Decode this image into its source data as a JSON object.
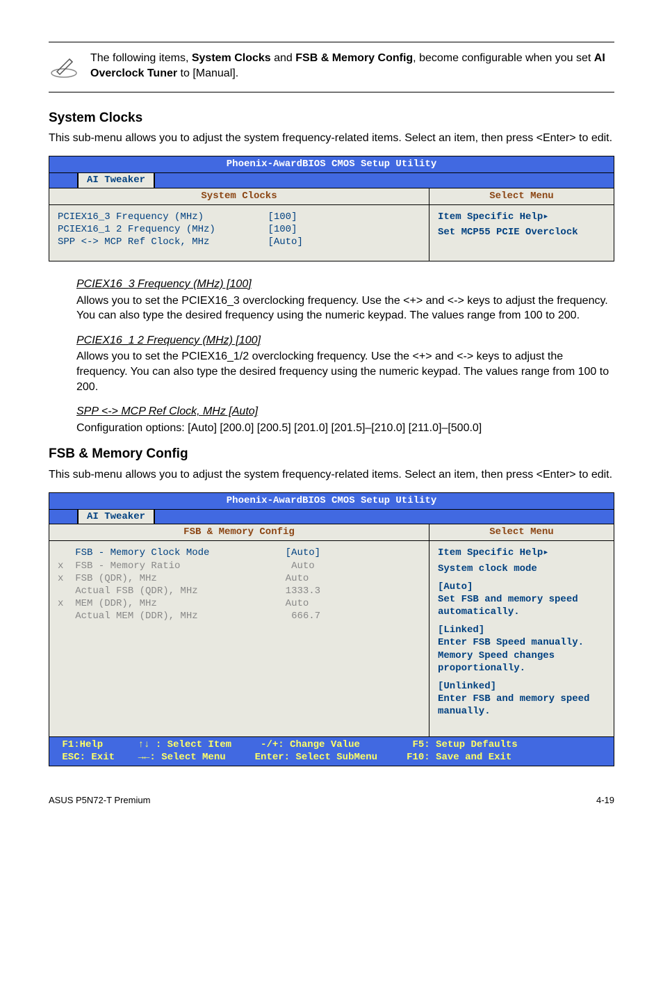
{
  "note": {
    "text_pre": "The following items, ",
    "bold1": "System Clocks",
    "mid": " and ",
    "bold2": "FSB & Memory Config",
    "post1": ", become configurable when you set ",
    "bold3": "AI Overclock Tuner",
    "post2": " to [Manual]."
  },
  "sec1": {
    "title": "System Clocks",
    "intro": "This sub-menu allows you to adjust the system frequency-related items. Select an item, then press <Enter> to edit."
  },
  "bios1": {
    "title": "Phoenix-AwardBIOS CMOS Setup Utility",
    "tab": "AI Tweaker",
    "left_header": "System Clocks",
    "right_header": "Select Menu",
    "row1_label": "PCIEX16_3 Frequency (MHz)",
    "row1_val": "[100]",
    "row2_label": "PCIEX16_1 2 Frequency (MHz)",
    "row2_val": "[100]",
    "row3_label": "SPP <-> MCP Ref Clock, MHz",
    "row3_val": "[Auto]",
    "help_title": "Item Specific Help▸",
    "help_body": "Set MCP55 PCIE Overclock"
  },
  "subs": {
    "a_title": "PCIEX16_3 Frequency (MHz) [100]",
    "a_body": "Allows you to set the PCIEX16_3 overclocking frequency. Use the <+> and <-> keys to adjust the frequency. You can also type the desired frequency using the numeric keypad. The values range from 100 to 200.",
    "b_title": "PCIEX16_1 2 Frequency (MHz) [100]",
    "b_body_pre": "Allows you to set the PCIEX16_1/2 overclocking frequency. ",
    "b_body_bold": "Use the <+> and",
    "b_body_post": " <-> keys to adjust the frequency. You can also type the desired frequency using the numeric keypad. The values range from 100 to 200.",
    "c_title": "SPP <-> MCP Ref Clock, MHz [Auto]",
    "c_body": "Configuration options: [Auto] [200.0] [200.5] [201.0] [201.5]–[210.0] [211.0]–[500.0]"
  },
  "sec2": {
    "title": "FSB & Memory Config",
    "intro": "This sub-menu allows you to adjust the system frequency-related items. Select an item, then press <Enter> to edit."
  },
  "bios2": {
    "title": "Phoenix-AwardBIOS CMOS Setup Utility",
    "tab": "AI Tweaker",
    "left_header": "FSB & Memory Config",
    "right_header": "Select Menu",
    "r1l": "   FSB - Memory Clock Mode",
    "r1v": "[Auto]",
    "r2l": "x  FSB - Memory Ratio",
    "r2v": " Auto",
    "r3l": "x  FSB (QDR), MHz",
    "r3v": " Auto",
    "r4l": "   Actual FSB (QDR), MHz",
    "r4v": " 1333.3",
    "r5l": "x  MEM (DDR), MHz",
    "r5v": " Auto",
    "r6l": "   Actual MEM (DDR), MHz",
    "r6v": "  666.7",
    "help_title": "Item Specific Help▸",
    "h1": "System clock mode",
    "h2": "[Auto]",
    "h3": "Set FSB and memory speed automatically.",
    "h4": "[Linked]",
    "h5": "Enter FSB Speed manually. Memory Speed changes proportionally.",
    "h6": "[Unlinked]",
    "h7": "Enter FSB and memory speed manually.",
    "footer": " F1:Help      ↑↓ : Select Item     -/+: Change Value         F5: Setup Defaults\n ESC: Exit    →←: Select Menu     Enter: Select SubMenu     F10: Save and Exit"
  },
  "footer": {
    "left": "ASUS P5N72-T Premium",
    "right": "4-19"
  }
}
